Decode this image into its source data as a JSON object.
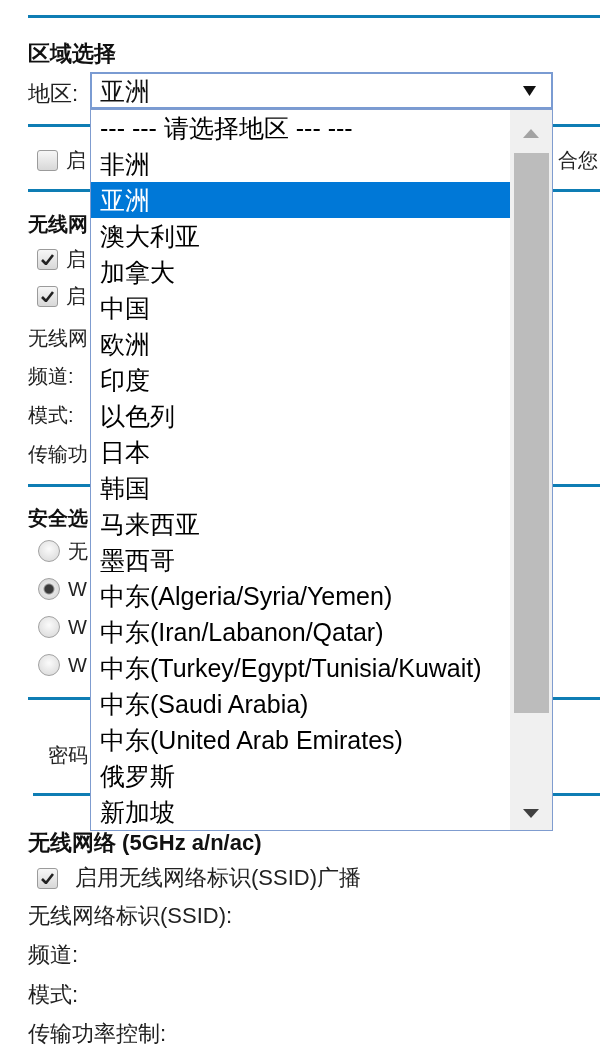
{
  "region": {
    "title": "区域选择",
    "label": "地区:",
    "select": {
      "value": "亚洲",
      "expanded": true,
      "options": [
        {
          "label": "--- --- 请选择地区 --- ---",
          "selected": false
        },
        {
          "label": "非洲",
          "selected": false
        },
        {
          "label": "亚洲",
          "selected": true
        },
        {
          "label": "澳大利亚",
          "selected": false
        },
        {
          "label": "加拿大",
          "selected": false
        },
        {
          "label": "中国",
          "selected": false
        },
        {
          "label": "欧洲",
          "selected": false
        },
        {
          "label": "印度",
          "selected": false
        },
        {
          "label": "以色列",
          "selected": false
        },
        {
          "label": "日本",
          "selected": false
        },
        {
          "label": "韩国",
          "selected": false
        },
        {
          "label": "马来西亚",
          "selected": false
        },
        {
          "label": "墨西哥",
          "selected": false
        },
        {
          "label": "中东(Algeria/Syria/Yemen)",
          "selected": false
        },
        {
          "label": "中东(Iran/Labanon/Qatar)",
          "selected": false
        },
        {
          "label": "中东(Turkey/Egypt/Tunisia/Kuwait)",
          "selected": false
        },
        {
          "label": "中东(Saudi Arabia)",
          "selected": false
        },
        {
          "label": "中东(United Arab Emirates)",
          "selected": false
        },
        {
          "label": "俄罗斯",
          "selected": false
        },
        {
          "label": "新加坡",
          "selected": false
        }
      ]
    }
  },
  "region_note": {
    "checked": false,
    "label_parts": [
      "启",
      "合您"
    ]
  },
  "wireless_section": {
    "title": "无线网",
    "checkboxes": [
      {
        "label": "启",
        "checked": true
      },
      {
        "label": "启",
        "checked": true
      }
    ],
    "fields": [
      {
        "label": "无线网"
      },
      {
        "label": "频道:"
      },
      {
        "label": "模式:"
      },
      {
        "label": "传输功"
      }
    ]
  },
  "security": {
    "title": "安全选",
    "options": [
      {
        "label": "无",
        "selected": false
      },
      {
        "label": "W",
        "selected": true
      },
      {
        "label": "W",
        "selected": false
      },
      {
        "label": "W",
        "selected": false
      }
    ],
    "password": {
      "label": "密码"
    }
  },
  "wireless_5ghz_section": {
    "title": "无线网络 (5GHz a/n/ac)",
    "checkboxes": [
      {
        "label": "启用无线网络标识(SSID)广播",
        "checked": true
      }
    ],
    "fields": [
      {
        "label": "无线网络标识(SSID):"
      },
      {
        "label": "频道:"
      },
      {
        "label": "模式:"
      },
      {
        "label": "传输功率控制:"
      }
    ]
  }
}
